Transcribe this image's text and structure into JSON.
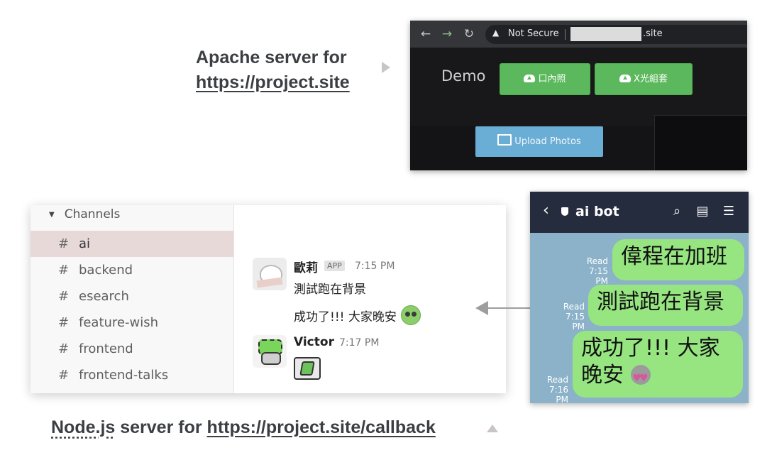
{
  "apache_caption": {
    "prefix": "Apache server for",
    "link": "https://project.site"
  },
  "browser": {
    "nav": {
      "back": "←",
      "forward": "→",
      "reload": "↻"
    },
    "address": {
      "warning_icon": "▲",
      "security_label": "Not Secure",
      "domain_suffix": ".site"
    },
    "page": {
      "brand": "Demo",
      "buttons": [
        {
          "label": "口內照",
          "icon": "cloud-upload-icon"
        },
        {
          "label": "X光組套",
          "icon": "cloud-upload-icon"
        }
      ],
      "upload_button": {
        "label": "Upload Photos",
        "icon": "image-icon"
      }
    }
  },
  "slack": {
    "sidebar": {
      "section_title": "Channels",
      "channels": [
        {
          "hash": "#",
          "name": "ai",
          "active": true
        },
        {
          "hash": "#",
          "name": "backend"
        },
        {
          "hash": "#",
          "name": "esearch"
        },
        {
          "hash": "#",
          "name": "feature-wish"
        },
        {
          "hash": "#",
          "name": "frontend"
        },
        {
          "hash": "#",
          "name": "frontend-talks"
        }
      ]
    },
    "messages": [
      {
        "author": "歐莉",
        "badge": "APP",
        "time": "7:15 PM",
        "lines": [
          "測試跑在背景",
          "成功了!!! 大家晚安"
        ]
      },
      {
        "author": "Victor",
        "time": "7:17 PM"
      }
    ]
  },
  "node_caption": {
    "nodejs": "Node.js",
    "middle": " server for ",
    "link": "https://project.site/callback"
  },
  "line_chat": {
    "header": {
      "back": "‹",
      "title": "ai bot",
      "search_icon": "⌕",
      "notes_icon": "▤",
      "menu_icon": "☰"
    },
    "messages": [
      {
        "read": "Read",
        "time": "7:15 PM",
        "text": "偉程在加班"
      },
      {
        "read": "Read",
        "time": "7:15 PM",
        "text": "測試跑在背景"
      },
      {
        "read": "Read",
        "time": "7:16 PM",
        "text_line1": "成功了!!! 大家",
        "text_line2": "晚安"
      }
    ]
  },
  "colors": {
    "green_button": "#5cb85c",
    "upload_button": "#6aadd5",
    "line_bubble": "#96e581",
    "line_header": "#252c3e",
    "active_channel": "#e8d9d9"
  }
}
